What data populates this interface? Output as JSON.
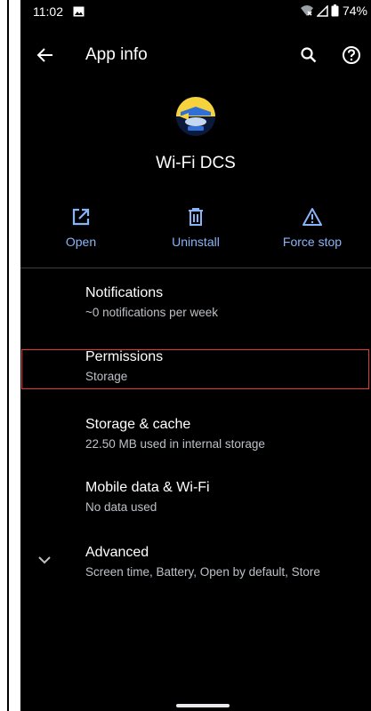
{
  "status_bar": {
    "time": "11:02",
    "battery": "74%"
  },
  "app_bar": {
    "title": "App info"
  },
  "app": {
    "name": "Wi-Fi DCS"
  },
  "actions": {
    "open": "Open",
    "uninstall": "Uninstall",
    "force_stop": "Force stop"
  },
  "settings": {
    "notifications": {
      "title": "Notifications",
      "subtitle": "~0 notifications per week"
    },
    "permissions": {
      "title": "Permissions",
      "subtitle": "Storage"
    },
    "storage": {
      "title": "Storage & cache",
      "subtitle": "22.50 MB used in internal storage"
    },
    "mobile_data": {
      "title": "Mobile data & Wi-Fi",
      "subtitle": "No data used"
    },
    "advanced": {
      "title": "Advanced",
      "subtitle": "Screen time, Battery, Open by default, Store"
    }
  },
  "colors": {
    "accent": "#8ab4f8",
    "background": "#000000",
    "highlight": "#e53935",
    "secondary_text": "#bdc1c6"
  },
  "icons": {
    "back": "arrow-left-icon",
    "search": "search-icon",
    "help": "help-circle-icon",
    "open": "open-external-icon",
    "uninstall": "trash-icon",
    "force_stop": "warning-triangle-icon",
    "advanced": "chevron-down-icon"
  }
}
